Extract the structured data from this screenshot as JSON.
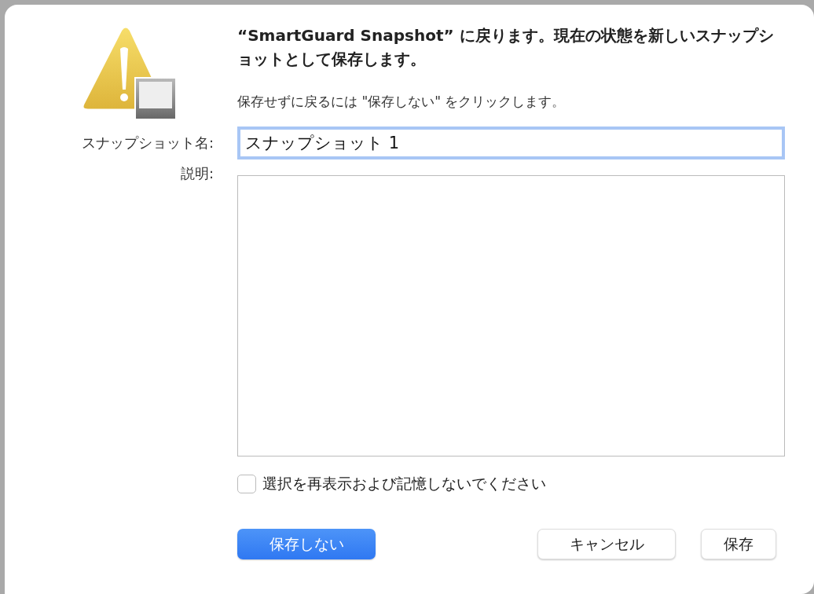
{
  "dialog": {
    "title": "“SmartGuard Snapshot” に戻ります。現在の状態を新しいスナップショットとして保存します。",
    "message": "保存せずに戻るには \"保存しない\" をクリックします。",
    "name_field": {
      "label": "スナップショット名:",
      "value": "スナップショット 1",
      "focused": true
    },
    "description_field": {
      "label": "説明:"
    },
    "remember_checkbox": {
      "label": "選択を再表示および記憶しないでください",
      "checked": false
    },
    "buttons": [
      {
        "label": "保存しない",
        "kind": "primary"
      },
      {
        "label": "キャンセル",
        "kind": "normal"
      },
      {
        "label": "保存",
        "kind": "normal"
      }
    ]
  }
}
